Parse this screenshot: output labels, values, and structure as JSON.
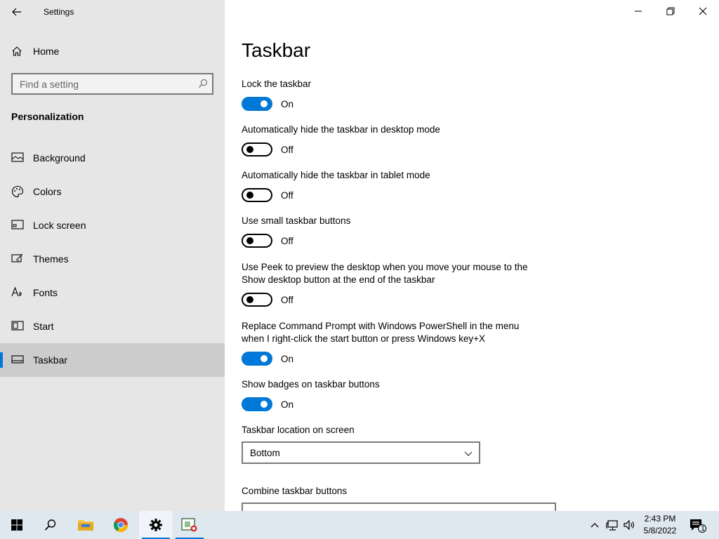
{
  "window": {
    "title": "Settings"
  },
  "sidebar": {
    "home_label": "Home",
    "search_placeholder": "Find a setting",
    "section_title": "Personalization",
    "items": [
      {
        "label": "Background",
        "icon": "picture-icon"
      },
      {
        "label": "Colors",
        "icon": "palette-icon"
      },
      {
        "label": "Lock screen",
        "icon": "lock-screen-icon"
      },
      {
        "label": "Themes",
        "icon": "themes-icon"
      },
      {
        "label": "Fonts",
        "icon": "fonts-icon"
      },
      {
        "label": "Start",
        "icon": "start-icon"
      },
      {
        "label": "Taskbar",
        "icon": "taskbar-icon",
        "selected": true
      }
    ]
  },
  "main": {
    "title": "Taskbar",
    "settings": [
      {
        "label": "Lock the taskbar",
        "state": "On"
      },
      {
        "label": "Automatically hide the taskbar in desktop mode",
        "state": "Off"
      },
      {
        "label": "Automatically hide the taskbar in tablet mode",
        "state": "Off"
      },
      {
        "label": "Use small taskbar buttons",
        "state": "Off"
      },
      {
        "label_line1": "Use Peek to preview the desktop when you move your mouse to the",
        "label_line2": "Show desktop button at the end of the taskbar",
        "state": "Off"
      },
      {
        "label_line1": "Replace Command Prompt with Windows PowerShell in the menu",
        "label_line2": "when I right-click the start button or press Windows key+X",
        "state": "On"
      },
      {
        "label": "Show badges on taskbar buttons",
        "state": "On"
      }
    ],
    "location": {
      "label": "Taskbar location on screen",
      "value": "Bottom"
    },
    "combine": {
      "label": "Combine taskbar buttons"
    }
  },
  "taskbar": {
    "time": "2:43 PM",
    "date": "5/8/2022",
    "notification_count": "1"
  },
  "colors": {
    "accent": "#0078d7",
    "sidebar_bg": "#e6e6e6",
    "selected_bg": "#cccccc",
    "taskbar_bg": "#dfe7ef"
  }
}
